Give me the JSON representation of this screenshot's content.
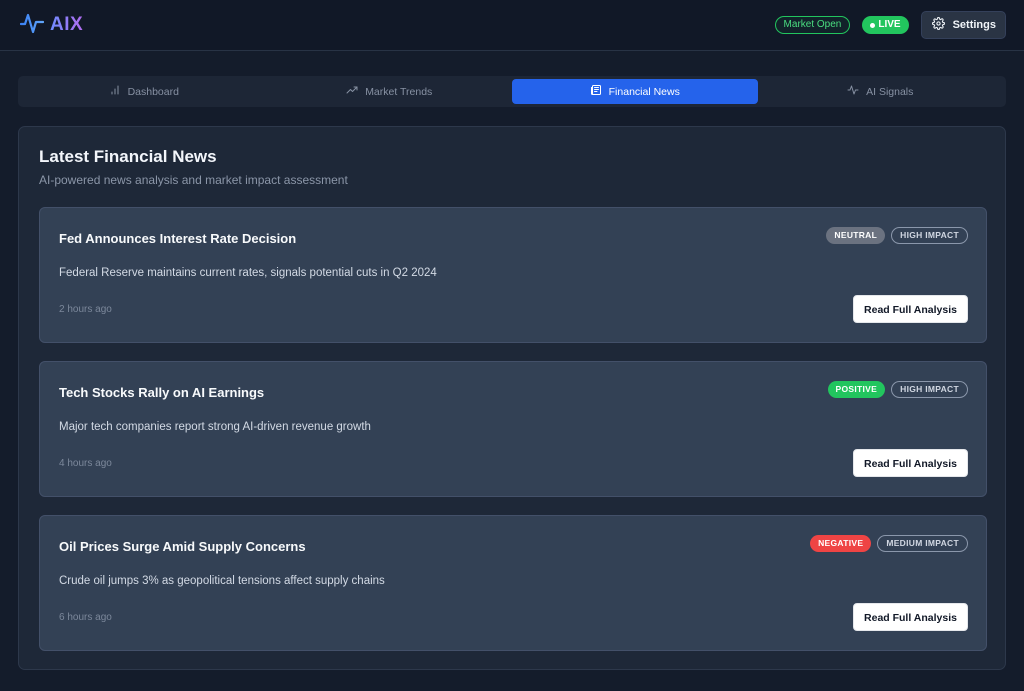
{
  "header": {
    "brand": "AIX",
    "market_status": "Market Open",
    "live_label": "LIVE",
    "settings_label": "Settings"
  },
  "tabs": [
    {
      "label": "Dashboard",
      "icon": "bar-chart-icon",
      "active": false
    },
    {
      "label": "Market Trends",
      "icon": "trending-up-icon",
      "active": false
    },
    {
      "label": "Financial News",
      "icon": "newspaper-icon",
      "active": true
    },
    {
      "label": "AI Signals",
      "icon": "activity-icon",
      "active": false
    }
  ],
  "panel": {
    "title": "Latest Financial News",
    "subtitle": "AI-powered news analysis and market impact assessment"
  },
  "news": [
    {
      "title": "Fed Announces Interest Rate Decision",
      "sentiment": "NEUTRAL",
      "sentiment_color": "#6b7280",
      "impact": "HIGH IMPACT",
      "description": "Federal Reserve maintains current rates, signals potential cuts in Q2 2024",
      "time": "2 hours ago",
      "button": "Read Full Analysis"
    },
    {
      "title": "Tech Stocks Rally on AI Earnings",
      "sentiment": "POSITIVE",
      "sentiment_color": "#22c55e",
      "impact": "HIGH IMPACT",
      "description": "Major tech companies report strong AI-driven revenue growth",
      "time": "4 hours ago",
      "button": "Read Full Analysis"
    },
    {
      "title": "Oil Prices Surge Amid Supply Concerns",
      "sentiment": "NEGATIVE",
      "sentiment_color": "#ef4444",
      "impact": "MEDIUM IMPACT",
      "description": "Crude oil jumps 3% as geopolitical tensions affect supply chains",
      "time": "6 hours ago",
      "button": "Read Full Analysis"
    }
  ],
  "colors": {
    "accent": "#2563eb",
    "live": "#22c55e",
    "background": "#141c2b",
    "card": "#334155"
  }
}
